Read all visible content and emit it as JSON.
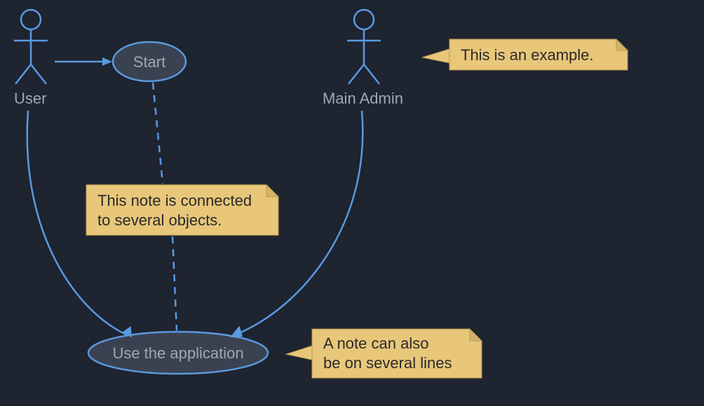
{
  "actors": {
    "user": {
      "label": "User"
    },
    "admin": {
      "label": "Main Admin"
    }
  },
  "usecases": {
    "start": {
      "label": "Start"
    },
    "useApp": {
      "label": "Use the application"
    }
  },
  "notes": {
    "example": {
      "line1": "This is an example."
    },
    "connected": {
      "line1": "This note is connected",
      "line2": "to several objects."
    },
    "multiline": {
      "line1": "A note can also",
      "line2": "be on several lines"
    }
  },
  "colors": {
    "background": "#1e2430",
    "stroke": "#5a9ae0",
    "note": "#e8c77a",
    "text": "#a0a8b5"
  }
}
